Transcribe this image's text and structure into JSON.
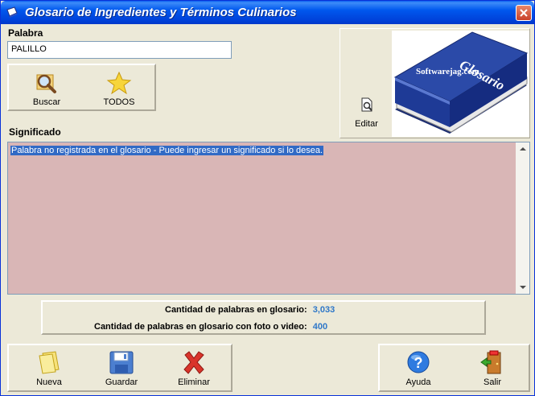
{
  "window": {
    "title": "Glosario de Ingredientes y Términos Culinarios"
  },
  "search": {
    "label": "Palabra",
    "value": "PALILLO"
  },
  "search_buttons": {
    "search_label": "Buscar",
    "all_label": "TODOS"
  },
  "edit": {
    "label": "Editar"
  },
  "logo": {
    "title_text": "Glosario",
    "brand_text": "Softwarejag.com"
  },
  "meaning": {
    "label": "Significado",
    "text": "Palabra no registrada en el glosario - Puede ingresar un significado si lo desea."
  },
  "stats": {
    "count_label": "Cantidad de palabras en glosario:",
    "count_value": "3,033",
    "photo_label": "Cantidad de palabras en glosario con foto o video:",
    "photo_value": "400"
  },
  "actions": {
    "new_label": "Nueva",
    "save_label": "Guardar",
    "delete_label": "Eliminar",
    "help_label": "Ayuda",
    "exit_label": "Salir"
  },
  "colors": {
    "titlebar": "#0058EE",
    "text_area_bg": "#D9B6B6",
    "selection": "#316AC5",
    "stat_value": "#2E77C8",
    "window_bg": "#ECE9D8"
  }
}
